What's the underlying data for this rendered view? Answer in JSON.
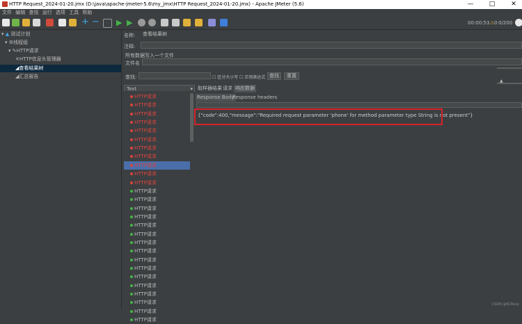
{
  "window": {
    "title": "HTTP Request_2024-01-20.jmx (D:\\java\\apache-jmeter-5.6\\my_jmx\\HTTP Request_2024-01-20.jmx) - Apache JMeter (5.6)",
    "minimize": "—",
    "maximize": "□",
    "close": "✕"
  },
  "menu": [
    "文件",
    "编辑",
    "查找",
    "运行",
    "选项",
    "工具",
    "帮助"
  ],
  "toolbar": {
    "elapsed": "00:00:53",
    "warn_count": "0",
    "threads": "0/200"
  },
  "tree": {
    "root": "测试计划",
    "thread_group": "线程组",
    "http_request": "HTTP请求",
    "header_manager": "HTTP信息头管理器",
    "view_results": "查看结果树",
    "summary": "汇总报告"
  },
  "form": {
    "name_label": "名称:",
    "name_value": "查看结果树",
    "comment_label": "注释:",
    "all_data_label": "所有数据写入一个文件",
    "filename_label": "文件名",
    "search_label": "查找:",
    "case_sensitive": "区分大小写",
    "regex": "正则表达式",
    "search_button": "查找",
    "reset_button": "重置"
  },
  "renderer": {
    "selected": "Text"
  },
  "tabs": {
    "sampler_result": "取样器结果",
    "request": "请求",
    "response_data": "响应数据",
    "response_body": "Response Body",
    "response_headers": "Response headers"
  },
  "results": {
    "label": "HTTP请求",
    "failed_count": 11,
    "success_count": 16,
    "selected_index": 8
  },
  "response": {
    "text": "{\"code\":400,\"message\":\"Required request parameter 'phone' for method parameter type String is not present\"}"
  },
  "watermark": "CSDN @KCRoxy",
  "colors": {
    "fail": "#e0443f",
    "ok": "#45b549",
    "highlight_border": "#d8232a",
    "selection": "#4a6ea9"
  }
}
